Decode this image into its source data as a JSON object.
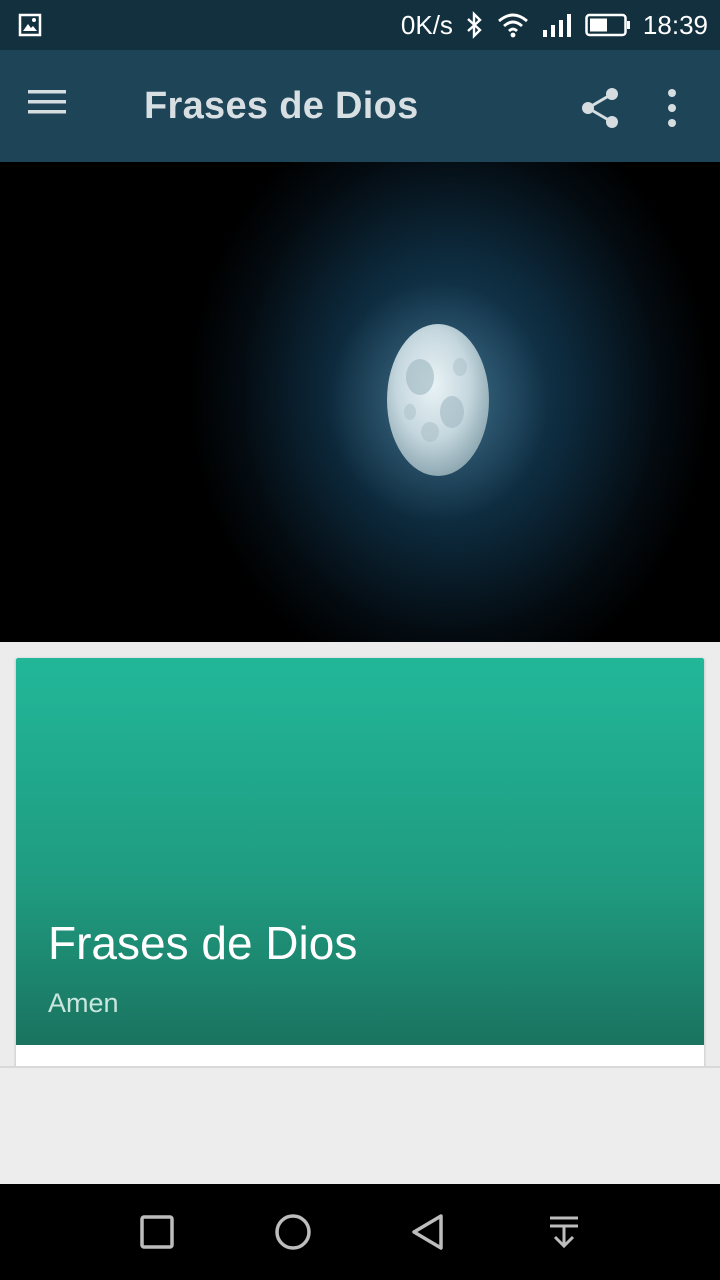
{
  "status_bar": {
    "net_speed": "0K/s",
    "time": "18:39",
    "icons": [
      "gallery-icon",
      "bluetooth-icon",
      "wifi-icon",
      "signal-icon",
      "battery-icon"
    ]
  },
  "toolbar": {
    "title": "Frases de Dios",
    "menu_icon": "menu-icon",
    "share_icon": "share-icon",
    "more_icon": "more-vert-icon"
  },
  "hero": {
    "image": "full-moon-night-sky"
  },
  "card": {
    "title": "Frases de Dios",
    "subtitle": "Amen",
    "accent_color": "#22b799"
  },
  "nav_bar": {
    "icons": [
      "recent-apps-icon",
      "home-icon",
      "back-icon",
      "notification-pull-icon"
    ]
  }
}
